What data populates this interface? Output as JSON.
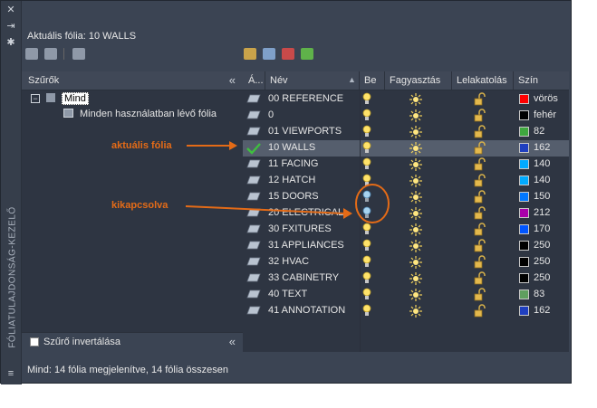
{
  "palette_title": "FÓLIATULAJDONSÁG-KEZELŐ",
  "current_layer": "Aktuális fólia: 10 WALLS",
  "filters_panel": {
    "header": "Szűrők",
    "tree": [
      {
        "label": "Mind",
        "selected": true
      },
      {
        "label": "Minden használatban lévő fólia"
      }
    ],
    "invert_filter_label": "Szűrő invertálása"
  },
  "grid": {
    "headers": {
      "status": "Á...",
      "name": "Név",
      "on": "Be",
      "freeze": "Fagyasztás",
      "lock": "Lelakatolás",
      "color": "Szín"
    },
    "rows": [
      {
        "name": "00 REFERENCE",
        "on": true,
        "color_name": "vörös",
        "color": "#ff0000"
      },
      {
        "name": "0",
        "on": true,
        "color_name": "fehér",
        "color": "#000000"
      },
      {
        "name": "01 VIEWPORTS",
        "on": true,
        "color_name": "82",
        "color": "#3fa73f"
      },
      {
        "name": "10 WALLS",
        "on": true,
        "color_name": "162",
        "color": "#1f3fbf",
        "current": true
      },
      {
        "name": "11 FACING",
        "on": true,
        "color_name": "140",
        "color": "#00aaff"
      },
      {
        "name": "12 HATCH",
        "on": true,
        "color_name": "140",
        "color": "#00aaff"
      },
      {
        "name": "15 DOORS",
        "on": false,
        "color_name": "150",
        "color": "#0077ff"
      },
      {
        "name": "20 ELECTRICAL",
        "on": false,
        "color_name": "212",
        "color": "#aa00aa"
      },
      {
        "name": "30 FXITURES",
        "on": true,
        "color_name": "170",
        "color": "#0055ff"
      },
      {
        "name": "31 APPLIANCES",
        "on": true,
        "color_name": "250",
        "color": "#000000"
      },
      {
        "name": "32 HVAC",
        "on": true,
        "color_name": "250",
        "color": "#000000"
      },
      {
        "name": "33 CABINETRY",
        "on": true,
        "color_name": "250",
        "color": "#000000"
      },
      {
        "name": "40 TEXT",
        "on": true,
        "color_name": "83",
        "color": "#5f9f5f"
      },
      {
        "name": "41 ANNOTATION",
        "on": true,
        "color_name": "162",
        "color": "#1f3fbf"
      }
    ]
  },
  "status_bar": "Mind: 14 fólia megjelenítve, 14 fólia összesen",
  "annotations": {
    "current_layer": "aktuális fólia",
    "off": "kikapcsolva"
  },
  "colors": {
    "accent": "#e46b17",
    "panel_bg": "#2e3542",
    "window_bg": "#3b4453",
    "selection": "#555e6d"
  }
}
